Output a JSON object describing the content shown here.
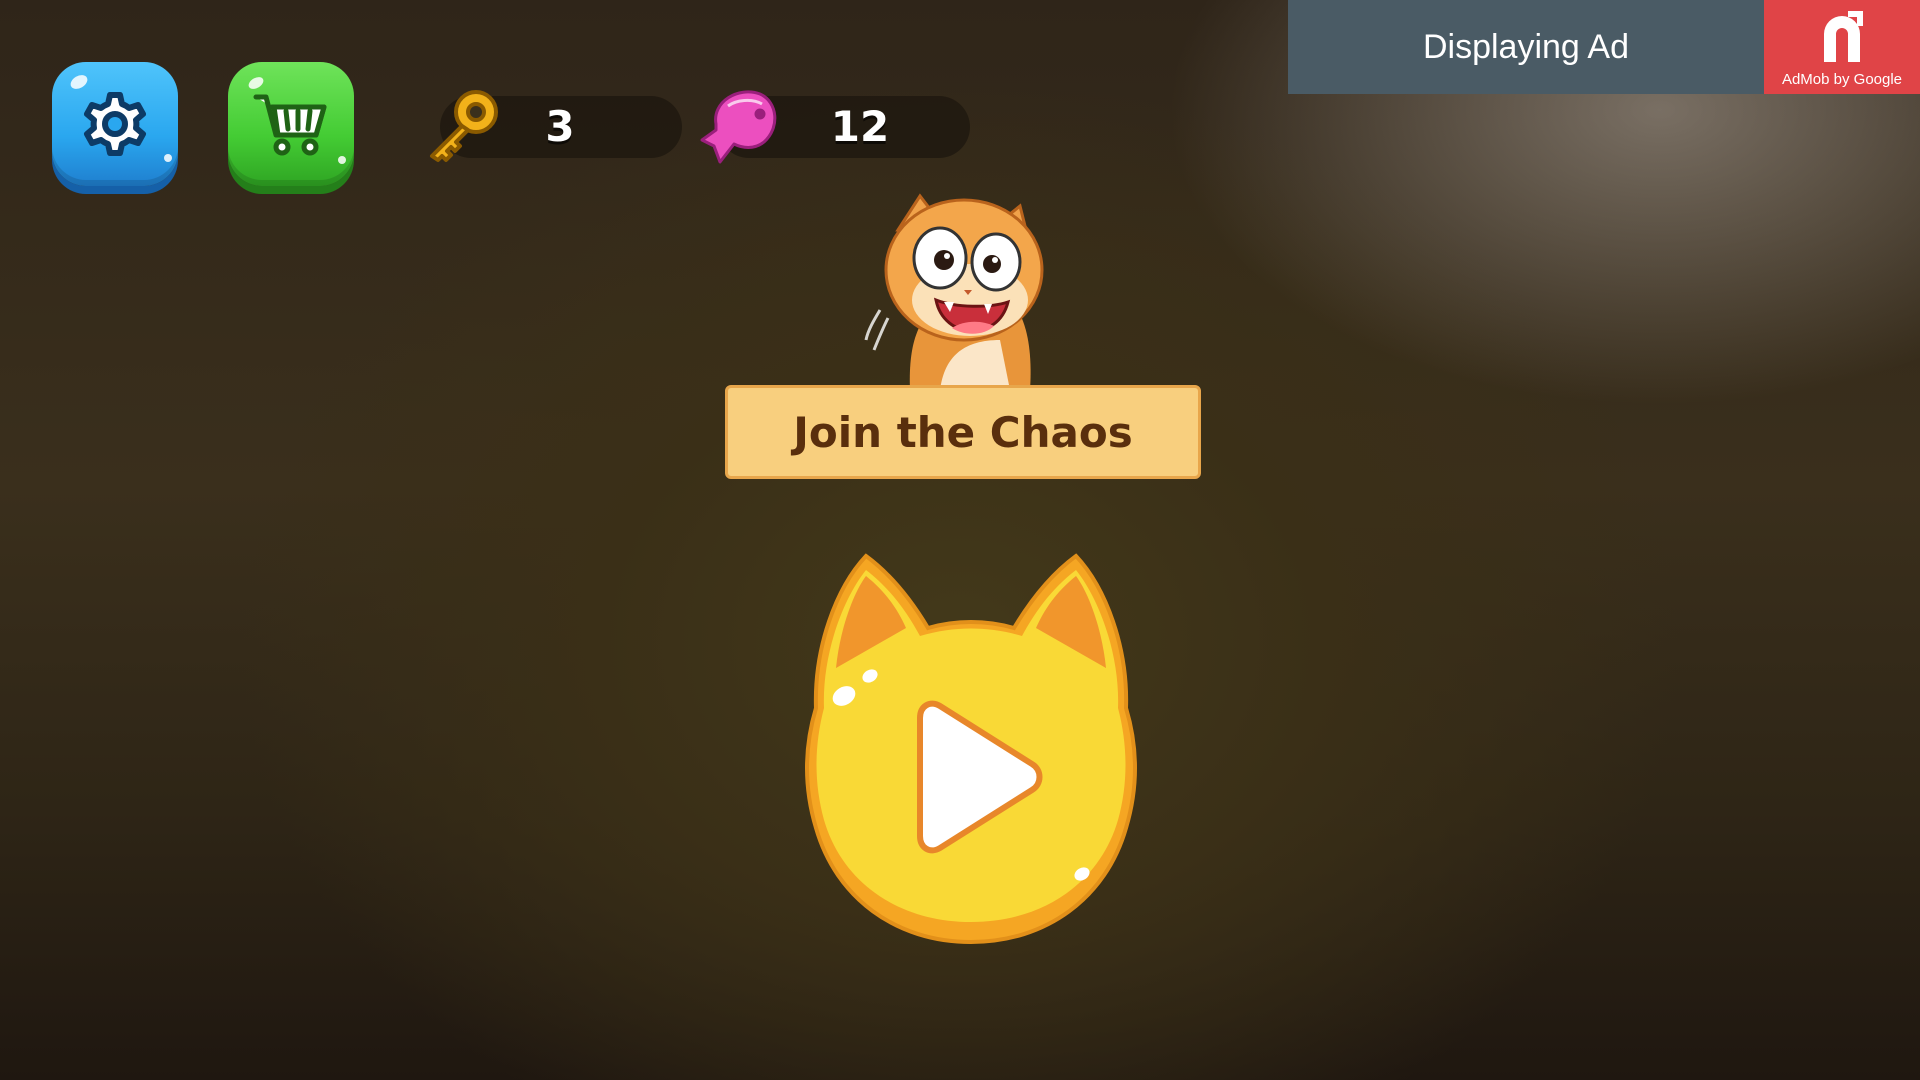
{
  "hud": {
    "settings_icon": "gear-icon",
    "shop_icon": "shopping-cart-icon",
    "keys": {
      "icon": "key-icon",
      "value": "3"
    },
    "fish": {
      "icon": "fish-icon",
      "value": "12"
    }
  },
  "ad": {
    "text": "Displaying Ad",
    "provider": "AdMob by Google",
    "logo_icon": "admob-logo-icon"
  },
  "main": {
    "mascot": "cat-mascot",
    "banner_text": "Join the Chaos",
    "play_icon": "play-icon"
  },
  "colors": {
    "settings_button": "#2aa7ef",
    "shop_button": "#44cc34",
    "banner_fill": "#f8cf7e",
    "play_button": "#f7d52c",
    "ad_banner": "#4a5b65",
    "admob_red": "#e04447"
  }
}
